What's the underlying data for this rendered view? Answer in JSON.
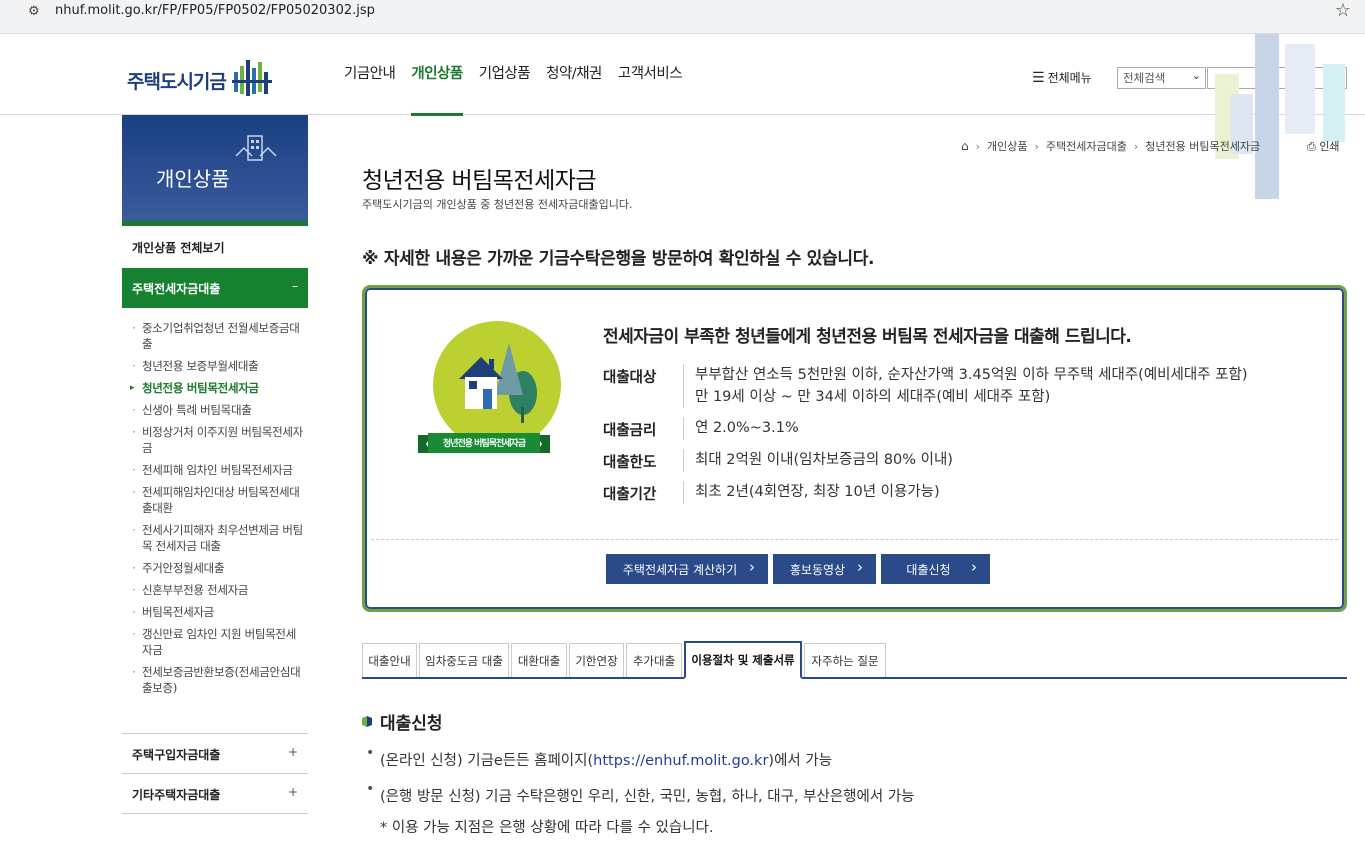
{
  "browser": {
    "url": "nhuf.molit.go.kr/FP/FP05/FP0502/FP05020302.jsp",
    "site_icon": "site-settings-icon",
    "star_icon": "bookmark-star-icon"
  },
  "header": {
    "logo_text": "주택도시기금",
    "nav": [
      "기금안내",
      "개인상품",
      "기업상품",
      "청약/채권",
      "고객서비스"
    ],
    "active_nav": "개인상품",
    "all_menu": "전체메뉴",
    "search_select": "전체검색",
    "search_placeholder": "",
    "accent_color": "#1a7a2e",
    "brand_color": "#1f3f7a"
  },
  "sidebar": {
    "title": "개인상품",
    "all_view": "개인상품 전체보기",
    "active_group": "주택전세자금대출",
    "active_group_toggle": "–",
    "sub_items": [
      "중소기업취업청년 전월세보증금대출",
      "청년전용 보증부월세대출",
      "청년전용 버팀목전세자금",
      "신생아 특례 버팀목대출",
      "비정상거처 이주지원 버팀목전세자금",
      "전세피해 임차인 버팀목전세자금",
      "전세피해임차인대상 버팀목전세대출대환",
      "전세사기피해자 최우선변제금 버팀목 전세자금 대출",
      "주거안정월세대출",
      "신혼부부전용 전세자금",
      "버팀목전세자금",
      "갱신만료 임차인 지원 버팀목전세자금",
      "전세보증금반환보증(전세금안심대출보증)"
    ],
    "current_sub": "청년전용 버팀목전세자금",
    "groups": [
      {
        "label": "주택구입자금대출",
        "toggle": "+"
      },
      {
        "label": "기타주택자금대출",
        "toggle": "+"
      }
    ]
  },
  "breadcrumb": [
    "개인상품",
    "주택전세자금대출",
    "청년전용 버팀목전세자금"
  ],
  "print_label": "인쇄",
  "page": {
    "title": "청년전용 버팀목전세자금",
    "description": "주택도시기금의 개인상품 중 청년전용 전세자금대출입니다.",
    "notice": "※ 자세한 내용은 가까운 기금수탁은행을 방문하여 확인하실 수 있습니다."
  },
  "info": {
    "badge_text": "청년전용 버팀목전세자금",
    "headline": "전세자금이 부족한 청년들에게 청년전용 버팀목 전세자금을 대출해 드립니다.",
    "rows": [
      {
        "label": "대출대상",
        "value": "부부합산 연소득 5천만원 이하, 순자산가액 3.45억원 이하 무주택 세대주(예비세대주 포함)",
        "value2": "만 19세 이상 ~ 만 34세 이하의 세대주(예비 세대주 포함)"
      },
      {
        "label": "대출금리",
        "value": "연 2.0%~3.1%"
      },
      {
        "label": "대출한도",
        "value": "최대 2억원 이내(임차보증금의 80% 이내)"
      },
      {
        "label": "대출기간",
        "value": "최초 2년(4회연장, 최장 10년 이용가능)"
      }
    ],
    "buttons": [
      "주택전세자금 계산하기",
      "홍보동영상",
      "대출신청"
    ]
  },
  "tabs": [
    "대출안내",
    "임차중도금 대출",
    "대환대출",
    "기한연장",
    "추가대출",
    "이용절차 및 제출서류",
    "자주하는 질문"
  ],
  "active_tab": "이용절차 및 제출서류",
  "section": {
    "title": "대출신청",
    "online_prefix": "(온라인 신청) 기금e든든 홈페이지(",
    "online_link": "https://enhuf.molit.go.kr",
    "online_suffix": ")에서 가능",
    "bank": "(은행 방문 신청) 기금 수탁은행인 우리, 신한, 국민, 농협, 하나, 대구, 부산은행에서 가능",
    "note": "* 이용 가능 지점은 은행 상황에 따라 다를 수 있습니다."
  }
}
